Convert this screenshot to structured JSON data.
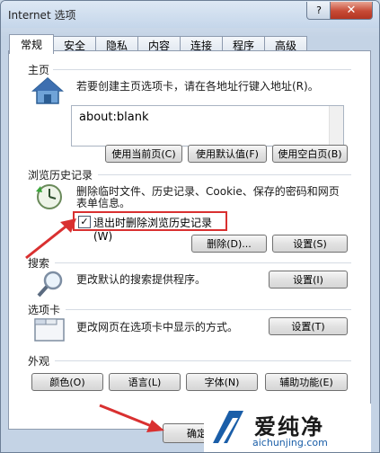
{
  "window": {
    "title": "Internet 选项",
    "help": "?",
    "close": "✕"
  },
  "tabs": [
    "常规",
    "安全",
    "隐私",
    "内容",
    "连接",
    "程序",
    "高级"
  ],
  "homepage": {
    "title": "主页",
    "desc": "若要创建主页选项卡，请在各地址行键入地址(R)。",
    "value": "about:blank",
    "btn_current": "使用当前页(C)",
    "btn_default": "使用默认值(F)",
    "btn_blank": "使用空白页(B)"
  },
  "history": {
    "title": "浏览历史记录",
    "desc1": "删除临时文件、历史记录、Cookie、保存的密码和网页",
    "desc2": "表单信息。",
    "checkbox_label": "退出时删除浏览历史记录(W)",
    "checkbox_checked": "✓",
    "btn_delete": "删除(D)...",
    "btn_settings": "设置(S)"
  },
  "search": {
    "title": "搜索",
    "desc": "更改默认的搜索提供程序。",
    "btn_settings": "设置(I)"
  },
  "tabs_section": {
    "title": "选项卡",
    "desc": "更改网页在选项卡中显示的方式。",
    "btn_settings": "设置(T)"
  },
  "appearance": {
    "title": "外观",
    "btn_colors": "颜色(O)",
    "btn_languages": "语言(L)",
    "btn_fonts": "字体(N)",
    "btn_accessibility": "辅助功能(E)"
  },
  "footer": {
    "ok": "确定"
  },
  "watermark": {
    "brand": "爱纯净",
    "url": "aichunjing.com"
  },
  "colors": {
    "highlight": "#d93030",
    "link_blue": "#1a5ea8"
  }
}
